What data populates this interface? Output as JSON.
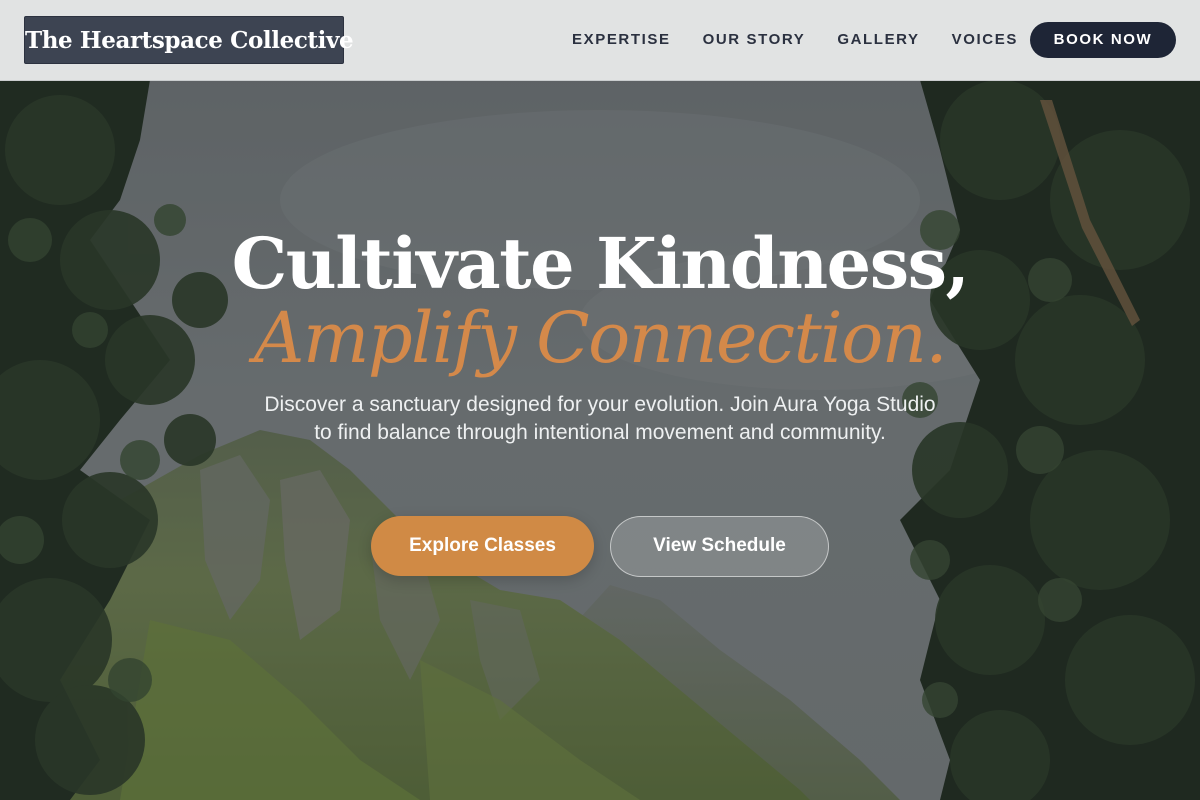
{
  "header": {
    "brand": "The Heartspace Collective",
    "nav": [
      "EXPERTISE",
      "OUR STORY",
      "GALLERY",
      "VOICES"
    ],
    "cta": "BOOK NOW"
  },
  "hero": {
    "title": "Cultivate Kindness,",
    "accent": "Amplify Connection.",
    "subtitle": "Discover a sanctuary designed for your evolution. Join Aura Yoga Studio to find balance through intentional movement and community.",
    "primary_button": "Explore Classes",
    "secondary_button": "View Schedule"
  },
  "colors": {
    "navy": "#1e2536",
    "brand_box": "#3d4452",
    "accent": "#d08a45",
    "header_bg": "#ecedee"
  }
}
